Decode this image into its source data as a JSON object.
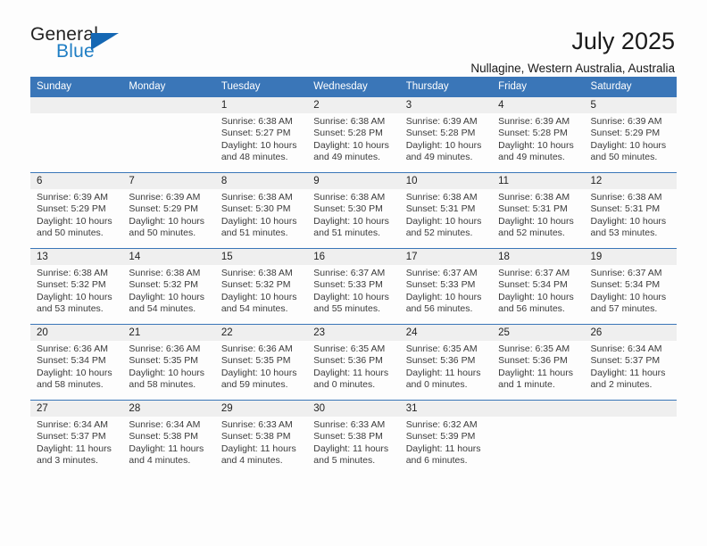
{
  "brand": {
    "name_part1": "General",
    "name_part2": "Blue",
    "accent_color": "#1567b3",
    "text_color": "#222222"
  },
  "header": {
    "title": "July 2025",
    "subtitle": "Nullagine, Western Australia, Australia"
  },
  "theme": {
    "header_band": "#3a76b8",
    "daynum_band": "#efefef",
    "cell_bg": "#fdfdfd",
    "body_text": "#3b3b3b"
  },
  "weekdays": [
    "Sunday",
    "Monday",
    "Tuesday",
    "Wednesday",
    "Thursday",
    "Friday",
    "Saturday"
  ],
  "weeks": [
    [
      {
        "day": "",
        "sunrise": "",
        "sunset": "",
        "daylight1": "",
        "daylight2": ""
      },
      {
        "day": "",
        "sunrise": "",
        "sunset": "",
        "daylight1": "",
        "daylight2": ""
      },
      {
        "day": "1",
        "sunrise": "Sunrise: 6:38 AM",
        "sunset": "Sunset: 5:27 PM",
        "daylight1": "Daylight: 10 hours",
        "daylight2": "and 48 minutes."
      },
      {
        "day": "2",
        "sunrise": "Sunrise: 6:38 AM",
        "sunset": "Sunset: 5:28 PM",
        "daylight1": "Daylight: 10 hours",
        "daylight2": "and 49 minutes."
      },
      {
        "day": "3",
        "sunrise": "Sunrise: 6:39 AM",
        "sunset": "Sunset: 5:28 PM",
        "daylight1": "Daylight: 10 hours",
        "daylight2": "and 49 minutes."
      },
      {
        "day": "4",
        "sunrise": "Sunrise: 6:39 AM",
        "sunset": "Sunset: 5:28 PM",
        "daylight1": "Daylight: 10 hours",
        "daylight2": "and 49 minutes."
      },
      {
        "day": "5",
        "sunrise": "Sunrise: 6:39 AM",
        "sunset": "Sunset: 5:29 PM",
        "daylight1": "Daylight: 10 hours",
        "daylight2": "and 50 minutes."
      }
    ],
    [
      {
        "day": "6",
        "sunrise": "Sunrise: 6:39 AM",
        "sunset": "Sunset: 5:29 PM",
        "daylight1": "Daylight: 10 hours",
        "daylight2": "and 50 minutes."
      },
      {
        "day": "7",
        "sunrise": "Sunrise: 6:39 AM",
        "sunset": "Sunset: 5:29 PM",
        "daylight1": "Daylight: 10 hours",
        "daylight2": "and 50 minutes."
      },
      {
        "day": "8",
        "sunrise": "Sunrise: 6:38 AM",
        "sunset": "Sunset: 5:30 PM",
        "daylight1": "Daylight: 10 hours",
        "daylight2": "and 51 minutes."
      },
      {
        "day": "9",
        "sunrise": "Sunrise: 6:38 AM",
        "sunset": "Sunset: 5:30 PM",
        "daylight1": "Daylight: 10 hours",
        "daylight2": "and 51 minutes."
      },
      {
        "day": "10",
        "sunrise": "Sunrise: 6:38 AM",
        "sunset": "Sunset: 5:31 PM",
        "daylight1": "Daylight: 10 hours",
        "daylight2": "and 52 minutes."
      },
      {
        "day": "11",
        "sunrise": "Sunrise: 6:38 AM",
        "sunset": "Sunset: 5:31 PM",
        "daylight1": "Daylight: 10 hours",
        "daylight2": "and 52 minutes."
      },
      {
        "day": "12",
        "sunrise": "Sunrise: 6:38 AM",
        "sunset": "Sunset: 5:31 PM",
        "daylight1": "Daylight: 10 hours",
        "daylight2": "and 53 minutes."
      }
    ],
    [
      {
        "day": "13",
        "sunrise": "Sunrise: 6:38 AM",
        "sunset": "Sunset: 5:32 PM",
        "daylight1": "Daylight: 10 hours",
        "daylight2": "and 53 minutes."
      },
      {
        "day": "14",
        "sunrise": "Sunrise: 6:38 AM",
        "sunset": "Sunset: 5:32 PM",
        "daylight1": "Daylight: 10 hours",
        "daylight2": "and 54 minutes."
      },
      {
        "day": "15",
        "sunrise": "Sunrise: 6:38 AM",
        "sunset": "Sunset: 5:32 PM",
        "daylight1": "Daylight: 10 hours",
        "daylight2": "and 54 minutes."
      },
      {
        "day": "16",
        "sunrise": "Sunrise: 6:37 AM",
        "sunset": "Sunset: 5:33 PM",
        "daylight1": "Daylight: 10 hours",
        "daylight2": "and 55 minutes."
      },
      {
        "day": "17",
        "sunrise": "Sunrise: 6:37 AM",
        "sunset": "Sunset: 5:33 PM",
        "daylight1": "Daylight: 10 hours",
        "daylight2": "and 56 minutes."
      },
      {
        "day": "18",
        "sunrise": "Sunrise: 6:37 AM",
        "sunset": "Sunset: 5:34 PM",
        "daylight1": "Daylight: 10 hours",
        "daylight2": "and 56 minutes."
      },
      {
        "day": "19",
        "sunrise": "Sunrise: 6:37 AM",
        "sunset": "Sunset: 5:34 PM",
        "daylight1": "Daylight: 10 hours",
        "daylight2": "and 57 minutes."
      }
    ],
    [
      {
        "day": "20",
        "sunrise": "Sunrise: 6:36 AM",
        "sunset": "Sunset: 5:34 PM",
        "daylight1": "Daylight: 10 hours",
        "daylight2": "and 58 minutes."
      },
      {
        "day": "21",
        "sunrise": "Sunrise: 6:36 AM",
        "sunset": "Sunset: 5:35 PM",
        "daylight1": "Daylight: 10 hours",
        "daylight2": "and 58 minutes."
      },
      {
        "day": "22",
        "sunrise": "Sunrise: 6:36 AM",
        "sunset": "Sunset: 5:35 PM",
        "daylight1": "Daylight: 10 hours",
        "daylight2": "and 59 minutes."
      },
      {
        "day": "23",
        "sunrise": "Sunrise: 6:35 AM",
        "sunset": "Sunset: 5:36 PM",
        "daylight1": "Daylight: 11 hours",
        "daylight2": "and 0 minutes."
      },
      {
        "day": "24",
        "sunrise": "Sunrise: 6:35 AM",
        "sunset": "Sunset: 5:36 PM",
        "daylight1": "Daylight: 11 hours",
        "daylight2": "and 0 minutes."
      },
      {
        "day": "25",
        "sunrise": "Sunrise: 6:35 AM",
        "sunset": "Sunset: 5:36 PM",
        "daylight1": "Daylight: 11 hours",
        "daylight2": "and 1 minute."
      },
      {
        "day": "26",
        "sunrise": "Sunrise: 6:34 AM",
        "sunset": "Sunset: 5:37 PM",
        "daylight1": "Daylight: 11 hours",
        "daylight2": "and 2 minutes."
      }
    ],
    [
      {
        "day": "27",
        "sunrise": "Sunrise: 6:34 AM",
        "sunset": "Sunset: 5:37 PM",
        "daylight1": "Daylight: 11 hours",
        "daylight2": "and 3 minutes."
      },
      {
        "day": "28",
        "sunrise": "Sunrise: 6:34 AM",
        "sunset": "Sunset: 5:38 PM",
        "daylight1": "Daylight: 11 hours",
        "daylight2": "and 4 minutes."
      },
      {
        "day": "29",
        "sunrise": "Sunrise: 6:33 AM",
        "sunset": "Sunset: 5:38 PM",
        "daylight1": "Daylight: 11 hours",
        "daylight2": "and 4 minutes."
      },
      {
        "day": "30",
        "sunrise": "Sunrise: 6:33 AM",
        "sunset": "Sunset: 5:38 PM",
        "daylight1": "Daylight: 11 hours",
        "daylight2": "and 5 minutes."
      },
      {
        "day": "31",
        "sunrise": "Sunrise: 6:32 AM",
        "sunset": "Sunset: 5:39 PM",
        "daylight1": "Daylight: 11 hours",
        "daylight2": "and 6 minutes."
      },
      {
        "day": "",
        "sunrise": "",
        "sunset": "",
        "daylight1": "",
        "daylight2": ""
      },
      {
        "day": "",
        "sunrise": "",
        "sunset": "",
        "daylight1": "",
        "daylight2": ""
      }
    ]
  ]
}
